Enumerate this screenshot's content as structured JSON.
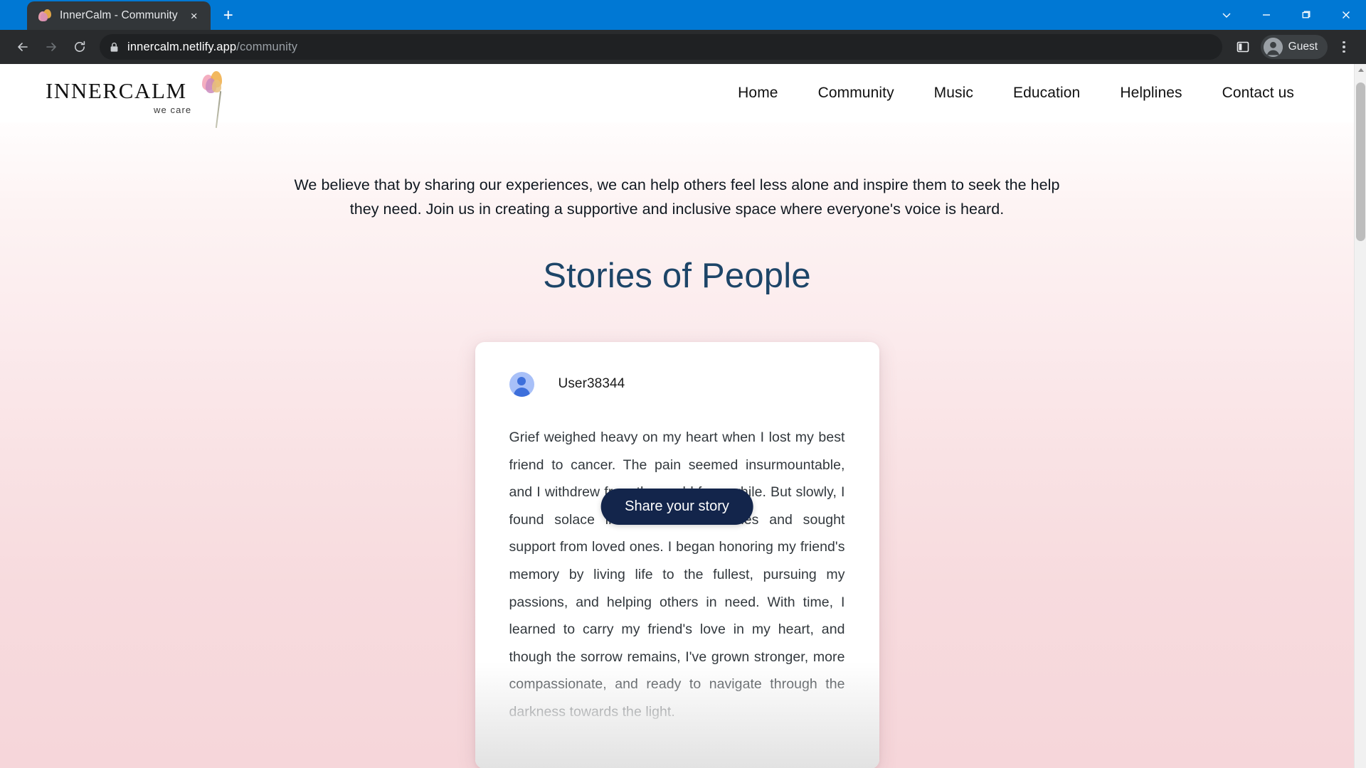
{
  "browser": {
    "tab": {
      "title": "InnerCalm - Community",
      "favicon_name": "innercalm-flower-favicon",
      "close_label": "×"
    },
    "new_tab_label": "+",
    "window_controls": [
      {
        "name": "tab-search-chevron",
        "label": "chevron-down-icon"
      },
      {
        "name": "minimize",
        "label": "minimize-icon"
      },
      {
        "name": "maximize",
        "label": "maximize-icon"
      },
      {
        "name": "close",
        "label": "close-icon"
      }
    ],
    "toolbar": {
      "back_label": "←",
      "forward_label": "→",
      "reload_label": "↻",
      "lock_label": "lock-icon",
      "url_domain": "innercalm.netlify.app",
      "url_path": "/community",
      "url_full": "innercalm.netlify.app/community",
      "side_panel_label": "side-panel-icon",
      "profile_label": "Guest",
      "menu_label": "kebab-menu-icon"
    },
    "theme": {
      "titlebar_bg": "#0078d4",
      "tab_bg": "#323639",
      "toolbar_bg": "#292b2d",
      "omnibox_bg": "#1f2123"
    }
  },
  "site": {
    "logo": {
      "name": "INNERCALM",
      "tagline": "we care",
      "mark": "watercolor-flower-icon"
    },
    "nav": [
      {
        "label": "Home"
      },
      {
        "label": "Community"
      },
      {
        "label": "Music"
      },
      {
        "label": "Education"
      },
      {
        "label": "Helplines"
      },
      {
        "label": "Contact us"
      }
    ]
  },
  "main": {
    "intro": "We believe that by sharing our experiences, we can help others feel less alone and inspire them to seek the help they need. Join us in creating a supportive and inclusive space where everyone's voice is heard.",
    "heading": "Stories of People",
    "heading_color": "#1d4568",
    "story_card": {
      "avatar": "user-avatar-icon",
      "username": "User38344",
      "text": "Grief weighed heavy on my heart when I lost my best friend to cancer. The pain seemed insurmountable, and I withdrew from the world for a while. But slowly, I found solace in cherished memories and sought support from loved ones. I began honoring my friend's memory by living life to the fullest, pursuing my passions, and helping others in need. With time, I learned to carry my friend's love in my heart, and though the sorrow remains, I've grown stronger, more compassionate, and ready to navigate through the darkness towards the light."
    },
    "share_button": {
      "label": "Share your story",
      "bg": "#13254b",
      "text_color": "#ffffff"
    }
  },
  "scrollbar": {
    "up_arrow": "scroll-up-arrow-icon"
  }
}
